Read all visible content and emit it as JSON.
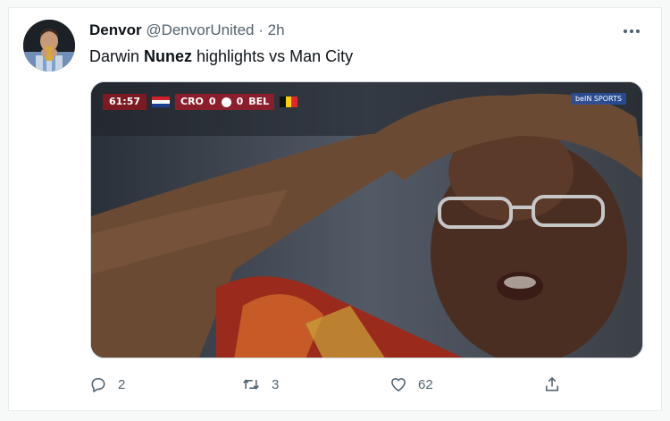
{
  "tweet": {
    "author_name": "Denvor",
    "author_handle": "@DenvorUnited",
    "separator": "·",
    "time": "2h",
    "text_before": "Darwin ",
    "text_bold": "Nunez",
    "text_after": " highlights vs Man City"
  },
  "media": {
    "scorebug": {
      "clock": "61:57",
      "home_team": "CRO",
      "home_score": "0",
      "away_score": "0",
      "away_team": "BEL"
    },
    "broadcaster_text": "beIN SPORTS"
  },
  "actions": {
    "replies": "2",
    "retweets": "3",
    "likes": "62"
  },
  "icons": {
    "more": "more-icon",
    "reply": "reply-icon",
    "retweet": "retweet-icon",
    "like": "heart-icon",
    "share": "share-icon"
  },
  "colors": {
    "text_primary": "#0f1419",
    "text_secondary": "#536471",
    "border": "#e6ecf0",
    "scorebug_red": "#8b1e2c"
  }
}
